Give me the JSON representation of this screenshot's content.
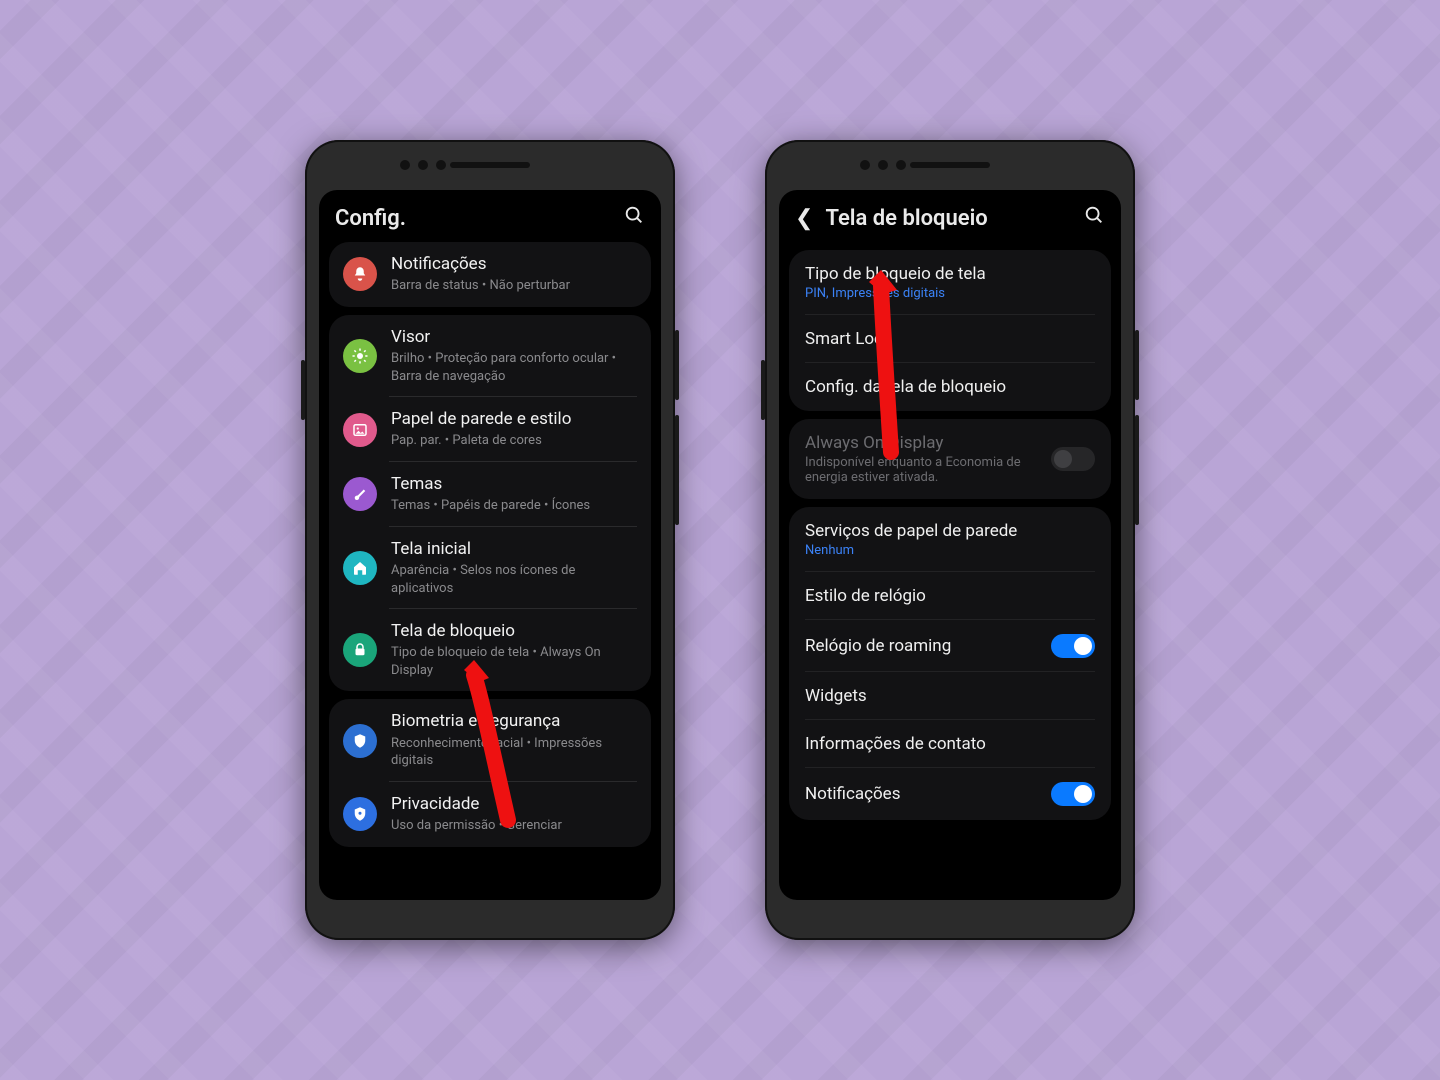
{
  "phoneA": {
    "header": {
      "title": "Config."
    },
    "groups": [
      {
        "rows": [
          {
            "title": "Notificações",
            "sub": "Barra de status  •  Não perturbar"
          }
        ]
      },
      {
        "rows": [
          {
            "title": "Visor",
            "sub": "Brilho  •  Proteção para conforto ocular  •  Barra de navegação"
          },
          {
            "title": "Papel de parede e estilo",
            "sub": "Pap. par.  •  Paleta de cores"
          },
          {
            "title": "Temas",
            "sub": "Temas  •  Papéis de parede  •  Ícones"
          },
          {
            "title": "Tela inicial",
            "sub": "Aparência  •  Selos nos ícones de aplicativos"
          },
          {
            "title": "Tela de bloqueio",
            "sub": "Tipo de bloqueio de tela  •  Always On Display"
          }
        ]
      },
      {
        "rows": [
          {
            "title": "Biometria e segurança",
            "sub": "Reconhecimento facial  •  Impressões digitais"
          },
          {
            "title": "Privacidade",
            "sub": "Uso da permissão  •  Gerenciar"
          }
        ]
      }
    ]
  },
  "phoneB": {
    "header": {
      "title": "Tela de bloqueio"
    },
    "sections": [
      {
        "rows": [
          {
            "title": "Tipo de bloqueio de tela",
            "sub": "PIN, Impressões digitais",
            "subClass": "blue"
          },
          {
            "title": "Smart Lock"
          },
          {
            "title": "Config. da tela de bloqueio"
          }
        ]
      },
      {
        "rows": [
          {
            "title": "Always On Display",
            "sub": "Indisponível enquanto a Economia de energia estiver ativada.",
            "subClass": "dim",
            "disabled": true,
            "toggle": "off-disabled"
          }
        ]
      },
      {
        "rows": [
          {
            "title": "Serviços de papel de parede",
            "sub": "Nenhum",
            "subClass": "blue"
          },
          {
            "title": "Estilo de relógio"
          },
          {
            "title": "Relógio de roaming",
            "toggle": "on"
          },
          {
            "title": "Widgets"
          },
          {
            "title": "Informações de contato"
          },
          {
            "title": "Notificações",
            "toggle": "on"
          }
        ]
      }
    ]
  }
}
